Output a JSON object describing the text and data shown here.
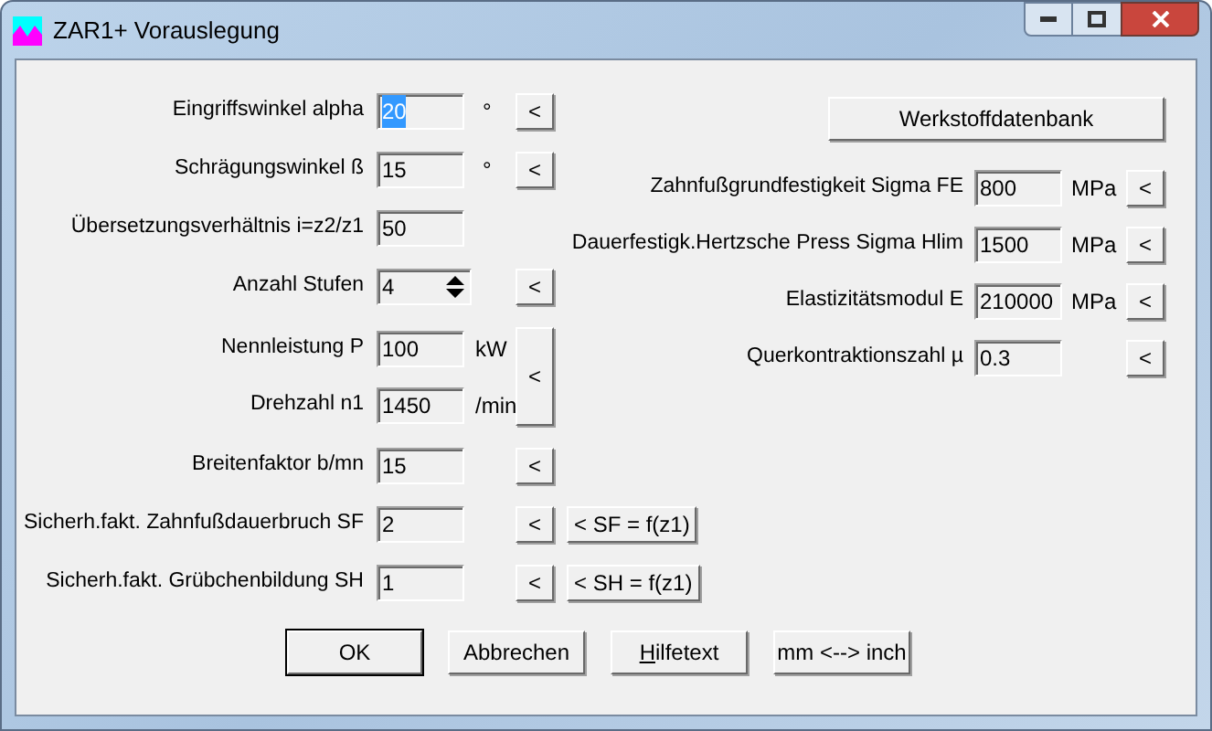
{
  "window": {
    "title": "ZAR1+ Vorauslegung"
  },
  "left_rows": [
    {
      "kind": "field",
      "label": "Eingriffswinkel alpha",
      "value": "20",
      "text_selected": true,
      "unit": "°",
      "button": "<"
    },
    {
      "kind": "field",
      "label": "Schrägungswinkel ß",
      "value": "15",
      "text_selected": false,
      "unit": "°",
      "button": "<"
    },
    {
      "kind": "field",
      "label": "Übersetzungsverhältnis i=z2/z1",
      "value": "50",
      "text_selected": false
    },
    {
      "kind": "spinner",
      "label": "Anzahl Stufen",
      "value": "4",
      "button": "<"
    },
    {
      "kind": "pair",
      "button": "<",
      "fields": [
        {
          "label": "Nennleistung P",
          "value": "100",
          "unit": "kW"
        },
        {
          "label": "Drehzahl n1",
          "value": "1450",
          "unit": "/min"
        }
      ]
    },
    {
      "kind": "field",
      "label": "Breitenfaktor b/mn",
      "value": "15",
      "text_selected": false,
      "button": "<"
    },
    {
      "kind": "field",
      "label": "Sicherh.fakt. Zahnfußdauerbruch SF",
      "value": "2",
      "text_selected": false,
      "button": "<",
      "extra_button": "< SF = f(z1)"
    },
    {
      "kind": "field",
      "label": "Sicherh.fakt. Grübchenbildung SH",
      "value": "1",
      "text_selected": false,
      "button": "<",
      "extra_button": "< SH = f(z1)"
    }
  ],
  "database_button": "Werkstoffdatenbank",
  "right_rows": [
    {
      "label": "Zahnfußgrundfestigkeit Sigma FE",
      "value": "800",
      "unit": "MPa",
      "button": "<"
    },
    {
      "label": "Dauerfestigk.Hertzsche Press Sigma Hlim",
      "value": "1500",
      "unit": "MPa",
      "button": "<"
    },
    {
      "label": "Elastizitätsmodul E",
      "value": "210000",
      "unit": "MPa",
      "button": "<"
    },
    {
      "label": "Querkontraktionszahl µ",
      "value": "0.3",
      "button": "<"
    }
  ],
  "buttons": [
    {
      "label": "OK",
      "default": true,
      "underline_first": false
    },
    {
      "label": "Abbrechen",
      "default": false,
      "underline_first": false
    },
    {
      "label": "Hilfetext",
      "default": false,
      "underline_first": true
    },
    {
      "label": "mm <--> inch",
      "default": false,
      "underline_first": false
    }
  ]
}
